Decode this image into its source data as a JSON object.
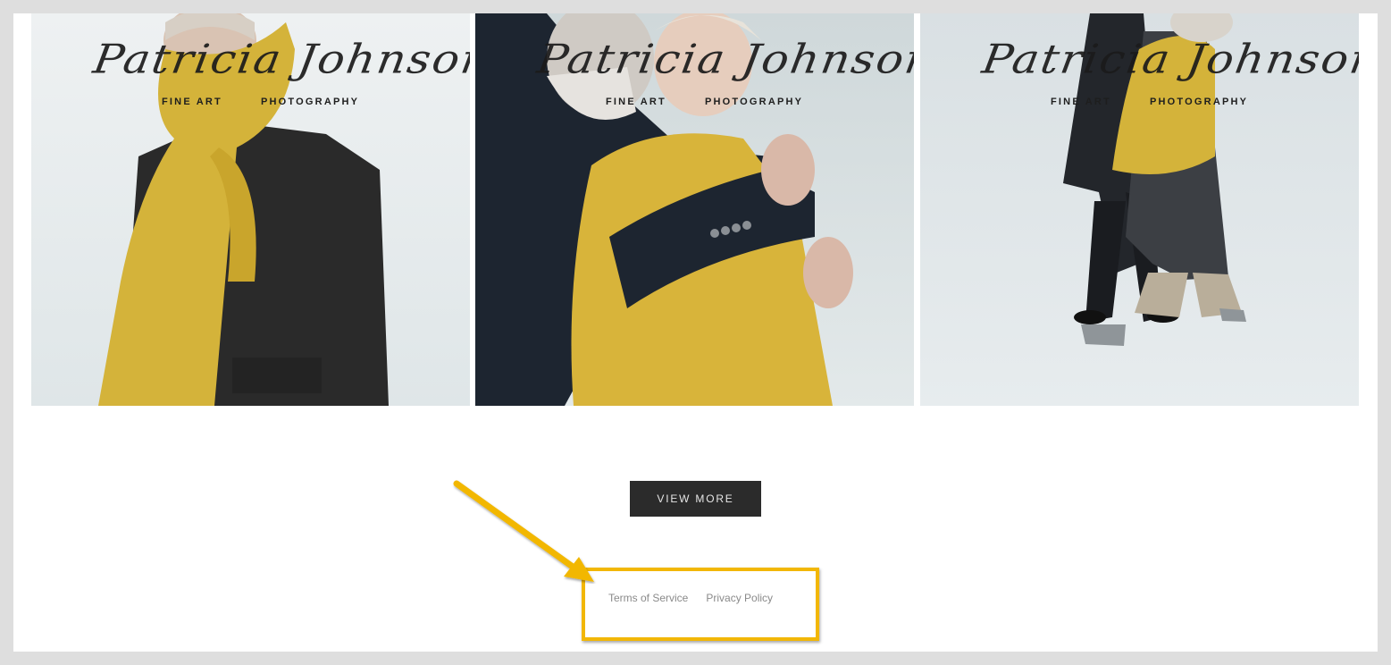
{
  "gallery": {
    "items": [
      {
        "watermark": {
          "script": "Patricia Johnson",
          "left": "FINE ART",
          "right": "PHOTOGRAPHY"
        }
      },
      {
        "watermark": {
          "script": "Patricia Johnson",
          "left": "FINE ART",
          "right": "PHOTOGRAPHY"
        }
      },
      {
        "watermark": {
          "script": "Patricia Johnson",
          "left": "FINE ART",
          "right": "PHOTOGRAPHY"
        }
      }
    ]
  },
  "view_more": {
    "label": "VIEW MORE"
  },
  "footer": {
    "links": [
      {
        "label": "Terms of Service"
      },
      {
        "label": "Privacy Policy"
      }
    ]
  },
  "colors": {
    "page_frame": "#dedede",
    "button_bg": "#2b2b2b",
    "annotation": "#f2b705",
    "scarf_yellow": "#d4b33a"
  }
}
